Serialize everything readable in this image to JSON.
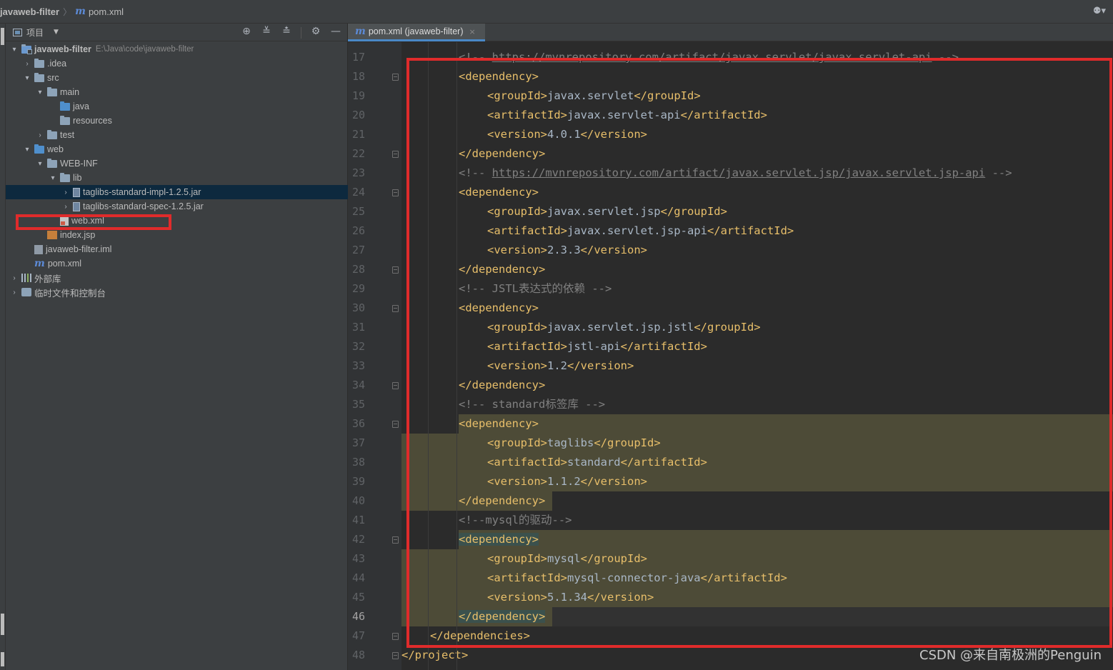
{
  "breadcrumb": {
    "project": "javaweb-filter",
    "separator": "〉",
    "file_icon": "m",
    "file": "pom.xml"
  },
  "user_menu": "⚉▾",
  "project_panel": {
    "title": "项目",
    "dropdown": "▼",
    "tools": [
      "⊕",
      "≚",
      "≛",
      "⚙",
      "—"
    ]
  },
  "tree": [
    {
      "indent": 0,
      "arrow": "▾",
      "icon": "folder-mod",
      "label": "javaweb-filter",
      "bold": true,
      "path": "E:\\Java\\code\\javaweb-filter"
    },
    {
      "indent": 1,
      "arrow": "›",
      "icon": "folder",
      "label": ".idea"
    },
    {
      "indent": 1,
      "arrow": "▾",
      "icon": "folder",
      "label": "src"
    },
    {
      "indent": 2,
      "arrow": "▾",
      "icon": "folder",
      "label": "main"
    },
    {
      "indent": 3,
      "arrow": "",
      "icon": "folder-blue",
      "label": "java"
    },
    {
      "indent": 3,
      "arrow": "",
      "icon": "folder",
      "label": "resources"
    },
    {
      "indent": 2,
      "arrow": "›",
      "icon": "folder",
      "label": "test"
    },
    {
      "indent": 1,
      "arrow": "▾",
      "icon": "folder-blue",
      "label": "web"
    },
    {
      "indent": 2,
      "arrow": "▾",
      "icon": "folder",
      "label": "WEB-INF"
    },
    {
      "indent": 3,
      "arrow": "▾",
      "icon": "folder",
      "label": "lib"
    },
    {
      "indent": 4,
      "arrow": "›",
      "icon": "jar",
      "label": "taglibs-standard-impl-1.2.5.jar",
      "selected": true
    },
    {
      "indent": 4,
      "arrow": "›",
      "icon": "jar",
      "label": "taglibs-standard-spec-1.2.5.jar"
    },
    {
      "indent": 3,
      "arrow": "",
      "icon": "xml",
      "label": "web.xml"
    },
    {
      "indent": 2,
      "arrow": "",
      "icon": "jsp",
      "label": "index.jsp"
    },
    {
      "indent": 1,
      "arrow": "",
      "icon": "iml",
      "label": "javaweb-filter.iml"
    },
    {
      "indent": 1,
      "arrow": "",
      "icon": "m",
      "label": "pom.xml"
    },
    {
      "indent": 0,
      "arrow": "›",
      "icon": "libs",
      "label": "外部库"
    },
    {
      "indent": 0,
      "arrow": "›",
      "icon": "scratch",
      "label": "临时文件和控制台"
    }
  ],
  "editor": {
    "tab_icon": "m",
    "tab_label": "pom.xml (javaweb-filter)",
    "tab_close": "×",
    "current_line": 46,
    "lines": [
      {
        "n": 17,
        "indent": 2,
        "kind": "comment",
        "text": "<!-- ",
        "url": "https://mvnrepository.com/artifact/javax.servlet/javax.servlet-api",
        "tail": " -->",
        "fold": false
      },
      {
        "n": 18,
        "indent": 2,
        "kind": "tag",
        "text": "<dependency>",
        "fold": true
      },
      {
        "n": 19,
        "indent": 3,
        "kind": "elem",
        "open": "<groupId>",
        "val": "javax.servlet",
        "close": "</groupId>"
      },
      {
        "n": 20,
        "indent": 3,
        "kind": "elem",
        "open": "<artifactId>",
        "val": "javax.servlet-api",
        "close": "</artifactId>"
      },
      {
        "n": 21,
        "indent": 3,
        "kind": "elem",
        "open": "<version>",
        "val": "4.0.1",
        "close": "</version>"
      },
      {
        "n": 22,
        "indent": 2,
        "kind": "tag",
        "text": "</dependency>",
        "fold": true
      },
      {
        "n": 23,
        "indent": 2,
        "kind": "comment",
        "text": "<!-- ",
        "url": "https://mvnrepository.com/artifact/javax.servlet.jsp/javax.servlet.jsp-api",
        "tail": " -->"
      },
      {
        "n": 24,
        "indent": 2,
        "kind": "tag",
        "text": "<dependency>",
        "fold": true
      },
      {
        "n": 25,
        "indent": 3,
        "kind": "elem",
        "open": "<groupId>",
        "val": "javax.servlet.jsp",
        "close": "</groupId>"
      },
      {
        "n": 26,
        "indent": 3,
        "kind": "elem",
        "open": "<artifactId>",
        "val": "javax.servlet.jsp-api",
        "close": "</artifactId>"
      },
      {
        "n": 27,
        "indent": 3,
        "kind": "elem",
        "open": "<version>",
        "val": "2.3.3",
        "close": "</version>"
      },
      {
        "n": 28,
        "indent": 2,
        "kind": "tag",
        "text": "</dependency>",
        "fold": true
      },
      {
        "n": 29,
        "indent": 2,
        "kind": "comment",
        "text": "<!-- JSTL表达式的依赖 -->"
      },
      {
        "n": 30,
        "indent": 2,
        "kind": "tag",
        "text": "<dependency>",
        "fold": true
      },
      {
        "n": 31,
        "indent": 3,
        "kind": "elem",
        "open": "<groupId>",
        "val": "javax.servlet.jsp.jstl",
        "close": "</groupId>"
      },
      {
        "n": 32,
        "indent": 3,
        "kind": "elem",
        "open": "<artifactId>",
        "val": "jstl-api",
        "close": "</artifactId>"
      },
      {
        "n": 33,
        "indent": 3,
        "kind": "elem",
        "open": "<version>",
        "val": "1.2",
        "close": "</version>"
      },
      {
        "n": 34,
        "indent": 2,
        "kind": "tag",
        "text": "</dependency>",
        "fold": true
      },
      {
        "n": 35,
        "indent": 2,
        "kind": "comment",
        "text": "<!-- standard标签库 -->"
      },
      {
        "n": 36,
        "indent": 2,
        "kind": "tag",
        "text": "<dependency>",
        "fold": true,
        "hl": "partial"
      },
      {
        "n": 37,
        "indent": 3,
        "kind": "elem",
        "open": "<groupId>",
        "val": "taglibs",
        "close": "</groupId>",
        "hl": "full"
      },
      {
        "n": 38,
        "indent": 3,
        "kind": "elem",
        "open": "<artifactId>",
        "val": "standard",
        "close": "</artifactId>",
        "hl": "full"
      },
      {
        "n": 39,
        "indent": 3,
        "kind": "elem",
        "open": "<version>",
        "val": "1.1.2",
        "close": "</version>",
        "hl": "full"
      },
      {
        "n": 40,
        "indent": 2,
        "kind": "tag",
        "text": "</dependency>",
        "fold": false,
        "hl": "end"
      },
      {
        "n": 41,
        "indent": 2,
        "kind": "comment",
        "text": "<!--mysql的驱动-->"
      },
      {
        "n": 42,
        "indent": 2,
        "kind": "tag",
        "text": "<dependency>",
        "fold": true,
        "hl": "partial",
        "taghl": true
      },
      {
        "n": 43,
        "indent": 3,
        "kind": "elem",
        "open": "<groupId>",
        "val": "mysql",
        "close": "</groupId>",
        "hl": "full"
      },
      {
        "n": 44,
        "indent": 3,
        "kind": "elem",
        "open": "<artifactId>",
        "val": "mysql-connector-java",
        "close": "</artifactId>",
        "hl": "full"
      },
      {
        "n": 45,
        "indent": 3,
        "kind": "elem",
        "open": "<version>",
        "val": "5.1.34",
        "close": "</version>",
        "hl": "full"
      },
      {
        "n": 46,
        "indent": 2,
        "kind": "tag",
        "text": "</dependency>",
        "fold": false,
        "hl": "end",
        "taghl": true
      },
      {
        "n": 47,
        "indent": 1,
        "kind": "tag",
        "text": "</dependencies>",
        "fold": true
      },
      {
        "n": 48,
        "indent": 0,
        "kind": "tag",
        "text": "</project>",
        "fold": true
      }
    ]
  },
  "watermark": "CSDN @来自南极洲的Penguin",
  "colors": {
    "highlight_box": "#e02b2b",
    "tag": "#e8bf6a",
    "comment": "#808080",
    "text": "#a9b7c6",
    "search_highlight": "#4d4b37"
  }
}
